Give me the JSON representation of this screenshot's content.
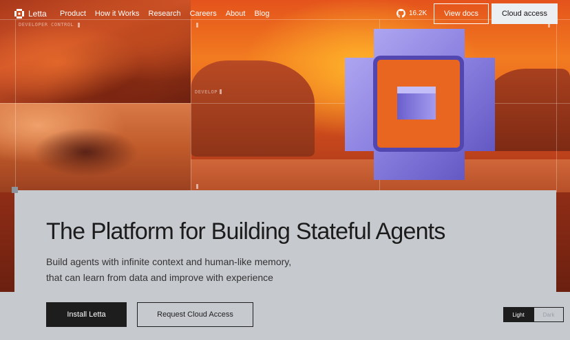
{
  "nav": {
    "brand": "Letta",
    "links": [
      "Product",
      "How it Works",
      "Research",
      "Careers",
      "About",
      "Blog"
    ],
    "github_stars": "16.2K",
    "view_docs": "View docs",
    "cloud_access": "Cloud access"
  },
  "hero": {
    "labels": [
      "DEVELOPER CONTROL",
      "DEVELOP"
    ],
    "title": "The Platform for Building Stateful Agents",
    "subtitle_line1": "Build agents with infinite context and human-like memory,",
    "subtitle_line2": "that can learn from data and improve with experience",
    "install_button": "Install Letta",
    "request_button": "Request Cloud Access"
  },
  "theme": {
    "light": "Light",
    "dark": "Dark",
    "selected": "Light"
  },
  "colors": {
    "accent_dark": "#1d1d1d",
    "card_bg": "#c6c9ce",
    "logo_purple": "#8f86e6"
  }
}
